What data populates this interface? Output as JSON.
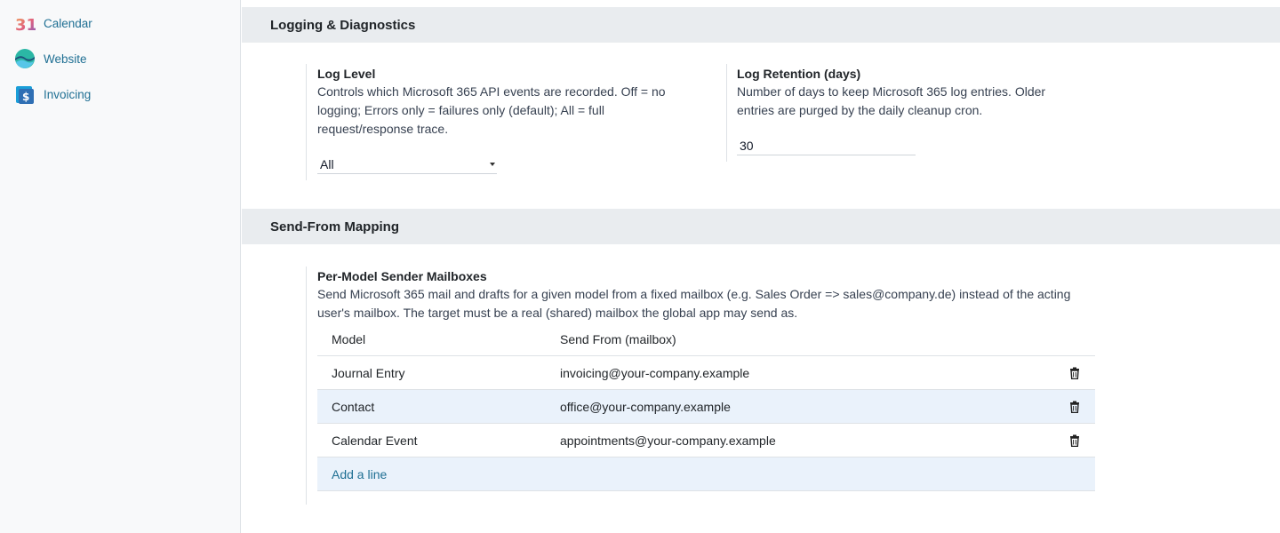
{
  "sidebar": {
    "apps": [
      {
        "label": "Calendar",
        "icon": "calendar-icon"
      },
      {
        "label": "Website",
        "icon": "website-icon"
      },
      {
        "label": "Invoicing",
        "icon": "invoicing-icon"
      }
    ],
    "calendar_icon_text": "31"
  },
  "logging": {
    "section_title": "Logging & Diagnostics",
    "log_level": {
      "title": "Log Level",
      "description": "Controls which Microsoft 365 API events are recorded. Off = no logging; Errors only = failures only (default); All = full request/response trace.",
      "selected": "All"
    },
    "log_retention": {
      "title": "Log Retention (days)",
      "description": "Number of days to keep Microsoft 365 log entries. Older entries are purged by the daily cleanup cron.",
      "value": "30"
    }
  },
  "send_from": {
    "section_title": "Send-From Mapping",
    "title": "Per-Model Sender Mailboxes",
    "description": "Send Microsoft 365 mail and drafts for a given model from a fixed mailbox (e.g. Sales Order => sales@company.de) instead of the acting user's mailbox. The target must be a real (shared) mailbox the global app may send as.",
    "columns": [
      "Model",
      "Send From (mailbox)"
    ],
    "rows": [
      {
        "model": "Journal Entry",
        "mailbox": "invoicing@your-company.example"
      },
      {
        "model": "Contact",
        "mailbox": "office@your-company.example"
      },
      {
        "model": "Calendar Event",
        "mailbox": "appointments@your-company.example"
      }
    ],
    "add_line": "Add a line"
  },
  "colors": {
    "link": "#1f6f93",
    "section_bg": "#e9ecef",
    "row_highlight": "#eaf2fb"
  }
}
